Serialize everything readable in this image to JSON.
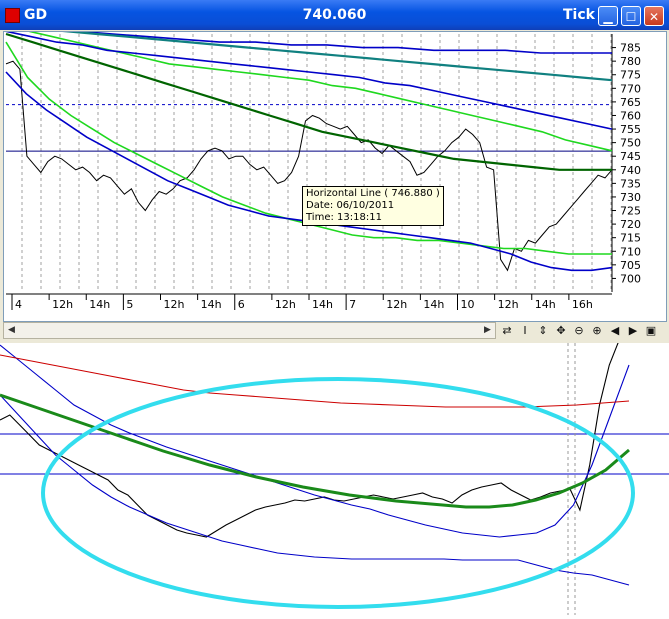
{
  "window": {
    "symbol": "GD",
    "price": "740.060",
    "mode": "Tick",
    "buttons": [
      "minimize",
      "maximize",
      "close"
    ]
  },
  "tooltip": {
    "line1": "Horizontal Line ( 746.880 )",
    "line2": "Date: 06/10/2011",
    "line3": "Time: 13:18:11"
  },
  "toolbar": {
    "icons": [
      "refresh-icon",
      "cursor-icon",
      "vertical-scale-icon",
      "move-icon",
      "zoom-out-icon",
      "zoom-in-icon",
      "scroll-left-icon",
      "scroll-right-icon",
      "panel-icon"
    ],
    "glyphs": [
      "⇄",
      "I",
      "⇕",
      "✥",
      "⊖",
      "⊕",
      "◀",
      "▶",
      "▣"
    ]
  },
  "chart_data": [
    {
      "type": "line",
      "title": "",
      "xlabel": "",
      "ylabel": "",
      "ylim": [
        695,
        790
      ],
      "x_ticks": [
        "4",
        "12h",
        "14h",
        "5",
        "12h",
        "14h",
        "6",
        "12h",
        "14h",
        "7",
        "12h",
        "14h",
        "10",
        "12h",
        "14h",
        "16h"
      ],
      "y_ticks": [
        700,
        705,
        710,
        715,
        720,
        725,
        730,
        735,
        740,
        745,
        750,
        755,
        760,
        765,
        770,
        775,
        780,
        785
      ],
      "grid": "vertical dashed",
      "horizontal_lines": [
        {
          "value": 764,
          "style": "dashed",
          "color": "#0000c8"
        },
        {
          "value": 746.88,
          "style": "solid",
          "color": "#000080"
        }
      ],
      "series": [
        {
          "color": "#000000",
          "values": [
            779,
            780,
            777,
            745,
            742,
            739,
            743,
            745,
            744,
            742,
            740,
            741,
            739,
            736,
            738,
            737,
            734,
            731,
            733,
            728,
            725,
            729,
            732,
            731,
            733,
            736,
            737,
            740,
            744,
            747,
            748,
            747,
            744,
            745,
            745,
            742,
            740,
            741,
            738,
            735,
            736,
            739,
            745,
            758,
            760,
            759,
            757,
            756,
            755,
            756,
            753,
            750,
            751,
            748,
            746,
            749,
            747,
            745,
            743,
            738,
            739,
            742,
            745,
            747,
            750,
            752,
            755,
            753,
            750,
            741,
            740,
            707,
            703,
            711,
            710,
            714,
            713,
            716,
            719,
            720,
            723,
            726,
            729,
            732,
            735,
            738,
            737,
            740
          ]
        },
        {
          "color": "#1fd81f",
          "values": [
            787,
            774,
            766,
            760,
            755,
            750,
            746,
            742,
            738,
            734,
            730,
            727,
            724,
            722,
            720,
            718,
            716,
            715,
            715,
            714,
            714,
            713,
            712,
            711,
            711,
            710,
            709,
            709,
            709
          ]
        },
        {
          "color": "#1fd81f",
          "values": [
            793,
            791,
            789,
            787,
            785,
            783,
            781,
            779,
            778,
            777,
            776,
            775,
            774,
            773,
            771,
            770,
            768,
            766,
            764,
            762,
            760,
            758,
            756,
            754,
            751,
            749,
            747
          ]
        },
        {
          "color": "#0000c8",
          "values": [
            776,
            768,
            762,
            757,
            752,
            748,
            744,
            740,
            736,
            733,
            730,
            727,
            725,
            723,
            722,
            721,
            720,
            719,
            718,
            717,
            716,
            715,
            714,
            713,
            711,
            709,
            706,
            704,
            703,
            703,
            704
          ]
        },
        {
          "color": "#0000c8",
          "values": [
            791,
            789,
            787,
            786,
            784,
            783,
            782,
            781,
            780,
            779,
            778,
            777,
            776,
            775,
            774,
            772,
            771,
            769,
            767,
            765,
            763,
            761,
            759,
            757,
            755
          ]
        },
        {
          "color": "#0000c8",
          "values": [
            793,
            792,
            791,
            790,
            789,
            788,
            787,
            787,
            786,
            786,
            785,
            785,
            784,
            784,
            784,
            783,
            783,
            783
          ]
        },
        {
          "color": "#006400",
          "values": [
            790,
            787,
            784,
            781,
            778,
            775,
            772,
            769,
            766,
            763,
            760,
            757,
            754,
            752,
            750,
            748,
            746,
            744,
            743,
            742,
            741,
            740,
            740,
            740
          ]
        },
        {
          "color": "#108080",
          "values": [
            793,
            792,
            791,
            790,
            789,
            788,
            787,
            786,
            785,
            784,
            783,
            782,
            781,
            780,
            779,
            778,
            777,
            776,
            775,
            774,
            773
          ]
        }
      ]
    },
    {
      "type": "line",
      "title": "",
      "series": [
        {
          "color": "#000000",
          "values": [
            195,
            200,
            190,
            180,
            170,
            165,
            160,
            155,
            150,
            145,
            140,
            135,
            125,
            120,
            110,
            100,
            95,
            90,
            85,
            82,
            80,
            78,
            84,
            90,
            95,
            100,
            105,
            108,
            110,
            112,
            115,
            114,
            116,
            118,
            115,
            114,
            116,
            118,
            120,
            118,
            116,
            118,
            120,
            122,
            118,
            116,
            112,
            120,
            125,
            128,
            130,
            132,
            125,
            120,
            115,
            118,
            122,
            124,
            126,
            105,
            150,
            210,
            250,
            275,
            290
          ]
        },
        {
          "color": "#0000c8",
          "values": [
            220,
            200,
            180,
            160,
            145,
            130,
            118,
            108,
            100,
            92,
            86,
            80,
            74,
            70,
            66,
            62,
            60,
            58,
            57,
            56,
            56,
            56,
            56,
            56,
            56,
            55,
            55,
            55,
            55,
            50,
            45,
            42,
            40,
            35,
            30
          ]
        },
        {
          "color": "#0000c8",
          "values": [
            270,
            255,
            240,
            225,
            210,
            200,
            190,
            182,
            175,
            168,
            162,
            156,
            150,
            144,
            138,
            132,
            126,
            120,
            115,
            110,
            106,
            100,
            95,
            90,
            86,
            82,
            80,
            78,
            80,
            82,
            90,
            110,
            150,
            200,
            250
          ]
        },
        {
          "color": "#cc0000",
          "values": [
            260,
            255,
            250,
            245,
            240,
            235,
            230,
            225,
            222,
            220,
            218,
            216,
            214,
            212,
            211,
            210,
            209,
            208,
            208,
            208,
            208,
            209,
            210,
            212,
            214
          ]
        },
        {
          "color": "#1a8a1a",
          "values": [
            220,
            212,
            204,
            196,
            188,
            180,
            172,
            164,
            157,
            150,
            144,
            138,
            133,
            128,
            124,
            120,
            117,
            114,
            112,
            110,
            108,
            108,
            110,
            115,
            122,
            132,
            145,
            165
          ]
        }
      ],
      "horizontal_lines": [
        {
          "color": "#0000c8"
        },
        {
          "color": "#0000c8"
        }
      ],
      "annotation": {
        "shape": "ellipse",
        "color": "#33ddee"
      }
    }
  ]
}
